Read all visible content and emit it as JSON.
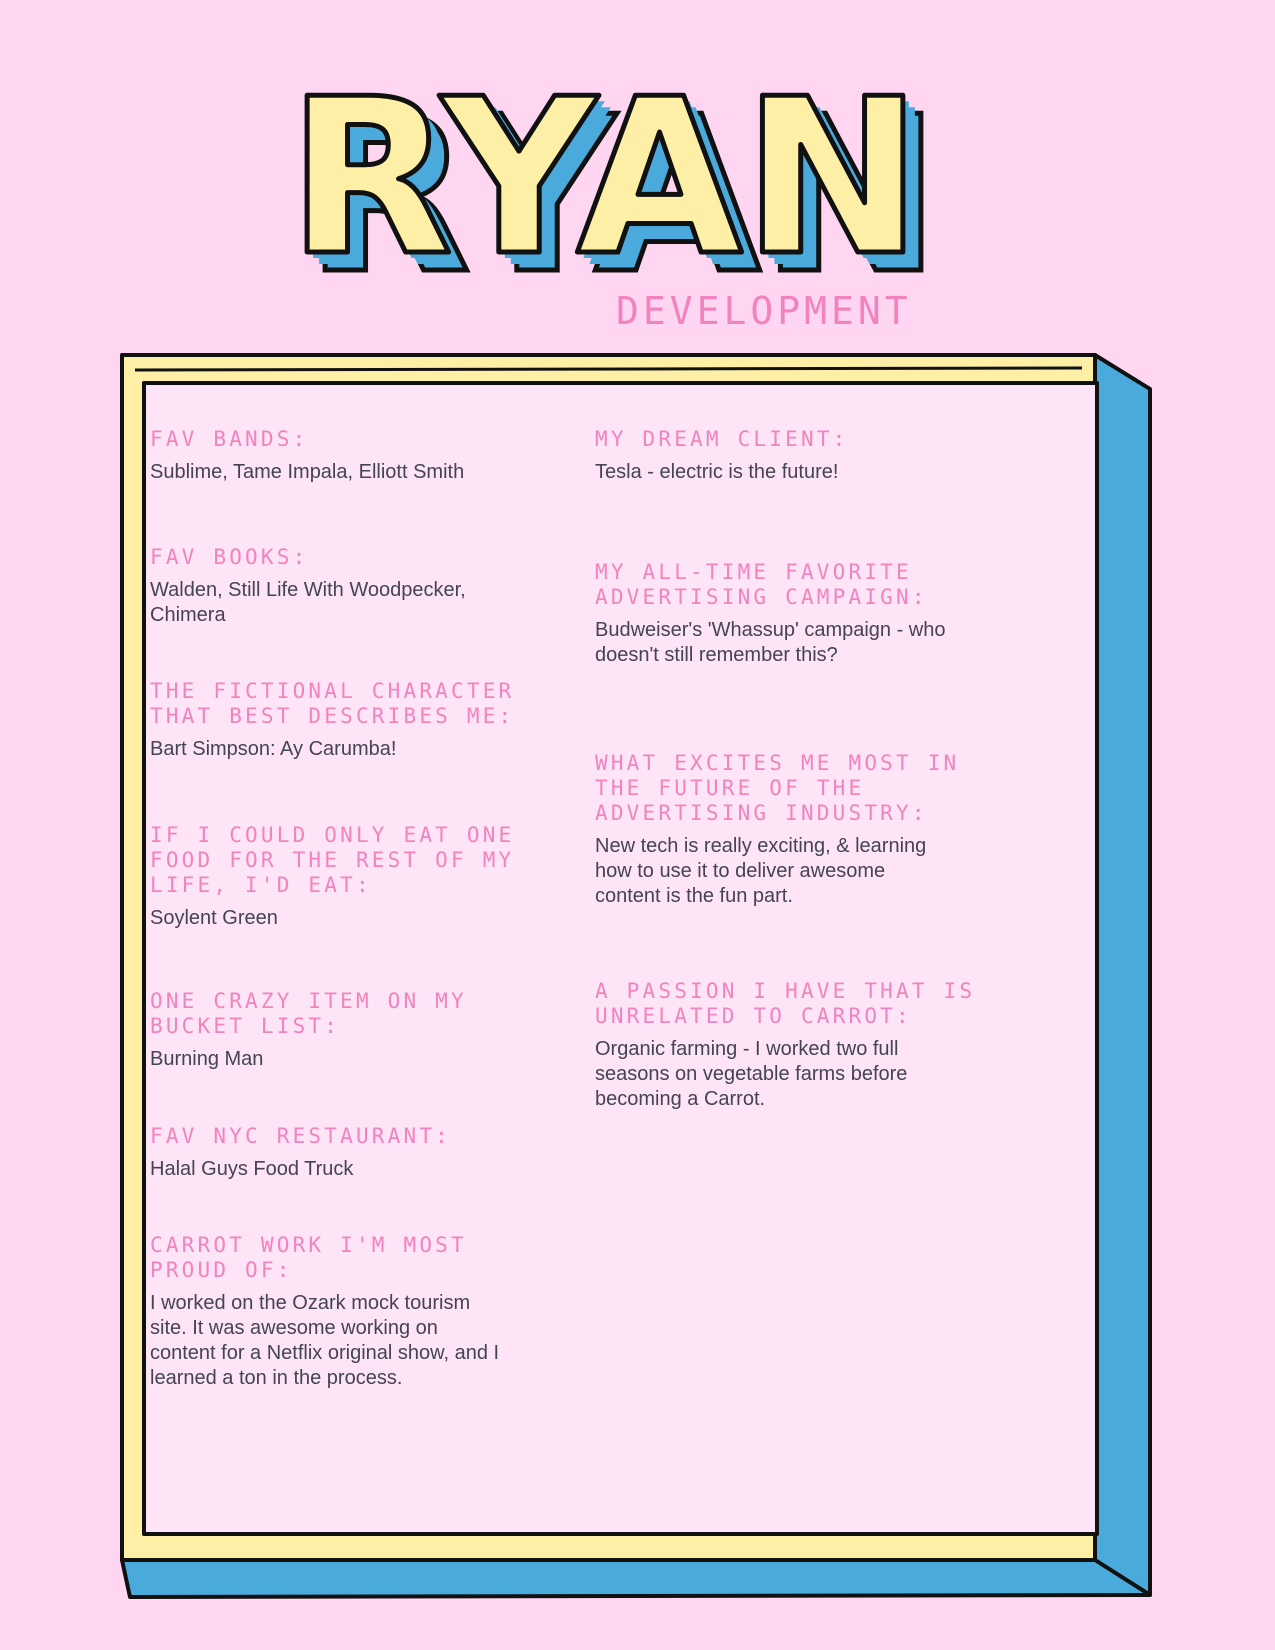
{
  "header": {
    "name": "RYAN",
    "department": "DEVELOPMENT"
  },
  "colors": {
    "background": "#fed6f2",
    "panel": "#fde4f6",
    "frame_yellow": "#fdf0a6",
    "frame_blue": "#4aaadc",
    "outline": "#111111",
    "accent_pink": "#f283bf",
    "body_text": "#444454"
  },
  "left_column": [
    {
      "question": "FAV BANDS:",
      "answer": "Sublime, Tame Impala, Elliott Smith"
    },
    {
      "question": "FAV BOOKS:",
      "answer": "Walden, Still Life With Woodpecker,\nChimera"
    },
    {
      "question": "THE FICTIONAL CHARACTER\nTHAT BEST DESCRIBES ME:",
      "answer": "Bart Simpson: Ay Carumba!"
    },
    {
      "question": "IF I COULD ONLY EAT ONE\nFOOD FOR THE REST OF MY\nLIFE, I'D EAT:",
      "answer": "Soylent Green"
    },
    {
      "question": "ONE CRAZY ITEM ON MY\nBUCKET LIST:",
      "answer": "Burning Man"
    },
    {
      "question": "FAV NYC RESTAURANT:",
      "answer": "Halal Guys Food Truck"
    },
    {
      "question": "CARROT WORK I'M MOST\nPROUD OF:",
      "answer": "I worked on the Ozark mock tourism\nsite. It was awesome working on\ncontent for a Netflix original show, and I\nlearned a ton in the process."
    }
  ],
  "right_column": [
    {
      "question": "MY DREAM CLIENT:",
      "answer": "Tesla - electric is the future!"
    },
    {
      "question": "MY ALL-TIME FAVORITE\nADVERTISING CAMPAIGN:",
      "answer": "Budweiser's 'Whassup' campaign - who\ndoesn't still remember this?"
    },
    {
      "question": "WHAT EXCITES ME MOST IN\nTHE FUTURE OF THE\nADVERTISING INDUSTRY:",
      "answer": "New tech is really exciting, & learning\nhow to use it to deliver awesome\ncontent is the fun part."
    },
    {
      "question": "A PASSION I HAVE THAT IS\nUNRELATED TO CARROT:",
      "answer": "Organic farming - I worked two full\nseasons on vegetable farms before\nbecoming a Carrot."
    }
  ]
}
